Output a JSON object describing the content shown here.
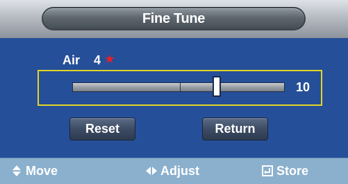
{
  "window": {
    "title": "Fine Tune"
  },
  "setting": {
    "label": "Air",
    "value": "4",
    "marker_icon": "star-icon",
    "marker_color": "#e0212b"
  },
  "slider": {
    "readout": "10",
    "level_fraction": 0.68,
    "frame_color": "#e2d726"
  },
  "buttons": {
    "reset_label": "Reset",
    "return_label": "Return"
  },
  "footer": {
    "move_label": "Move",
    "move_icon": "up-down-arrows-icon",
    "adjust_label": "Adjust",
    "adjust_icon": "left-right-arrows-icon",
    "store_label": "Store",
    "store_icon": "enter-icon"
  },
  "colors": {
    "panel_background": "#254f98",
    "footer_background": "#8ab0cd",
    "text": "#ffffff"
  }
}
